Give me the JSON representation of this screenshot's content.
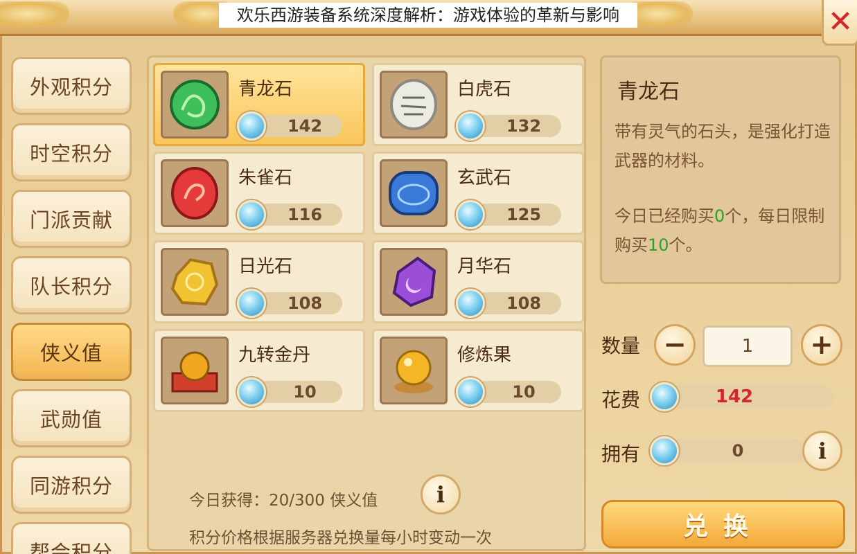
{
  "title": "欢乐西游装备系统深度解析：游戏体验的革新与影响",
  "sidebar": {
    "tabs": [
      {
        "label": "外观积分",
        "active": false
      },
      {
        "label": "时空积分",
        "active": false
      },
      {
        "label": "门派贡献",
        "active": false
      },
      {
        "label": "队长积分",
        "active": false
      },
      {
        "label": "侠义值",
        "active": true
      },
      {
        "label": "武勋值",
        "active": false
      },
      {
        "label": "同游积分",
        "active": false
      },
      {
        "label": "帮会积分",
        "active": false
      }
    ]
  },
  "items": [
    {
      "name": "青龙石",
      "price": "142",
      "icon": "green-dragon-stone-icon",
      "color": "#3fbf5a",
      "selected": true
    },
    {
      "name": "白虎石",
      "price": "132",
      "icon": "white-tiger-stone-icon",
      "color": "#e8e8e0",
      "selected": false
    },
    {
      "name": "朱雀石",
      "price": "116",
      "icon": "vermilion-bird-stone-icon",
      "color": "#e53a3a",
      "selected": false
    },
    {
      "name": "玄武石",
      "price": "125",
      "icon": "black-tortoise-stone-icon",
      "color": "#3b79d8",
      "selected": false
    },
    {
      "name": "日光石",
      "price": "108",
      "icon": "sunlight-stone-icon",
      "color": "#f1c231",
      "selected": false
    },
    {
      "name": "月华石",
      "price": "108",
      "icon": "moonlight-stone-icon",
      "color": "#9b4fd8",
      "selected": false
    },
    {
      "name": "九转金丹",
      "price": "10",
      "icon": "golden-elixir-icon",
      "color": "#f0a61e",
      "selected": false
    },
    {
      "name": "修炼果",
      "price": "10",
      "icon": "cultivation-fruit-icon",
      "color": "#f4b624",
      "selected": false
    }
  ],
  "footer": {
    "today_gain": "今日获得：20/300 侠义值",
    "note": "积分价格根据服务器兑换量每小时变动一次"
  },
  "detail": {
    "name": "青龙石",
    "description": "带有灵气的石头，是强化打造武器的材料。",
    "limit_prefix": "今日已经购买",
    "bought": "0",
    "limit_mid": "个，每日限制购买",
    "limit": "10",
    "limit_suffix": "个。"
  },
  "purchase": {
    "quantity_label": "数量",
    "quantity": "1",
    "cost_label": "花费",
    "cost": "142",
    "owned_label": "拥有",
    "owned": "0",
    "exchange_label": "兑换"
  },
  "colors": {
    "accent": "#f2a93a",
    "cost_red": "#d5262b",
    "limit_green": "#2aa12a"
  }
}
